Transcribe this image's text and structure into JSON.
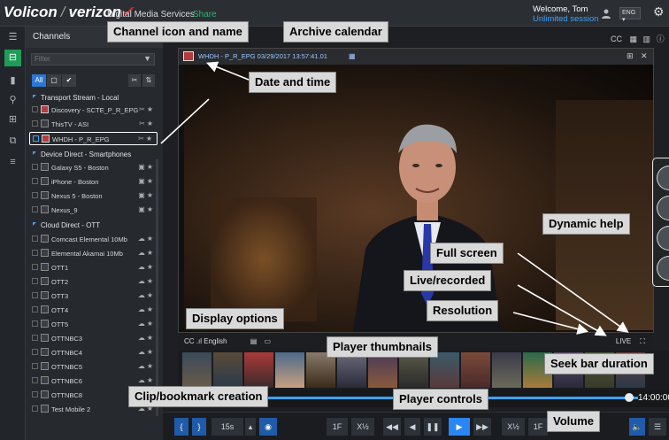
{
  "brand": {
    "name_left": "Volicon",
    "name_right": "verizon",
    "subtitle": "Digital Media Services",
    "share": "Share"
  },
  "user": {
    "welcome": "Welcome, Tom",
    "session": "Unlimited session",
    "language": "ENG"
  },
  "panel": {
    "title": "Channels",
    "filter_placeholder": "Filter",
    "chips": {
      "all": "All",
      "check": "✔"
    },
    "groups": [
      {
        "label": "Transport Stream - Local"
      },
      {
        "label": "Device Direct - Smartphones"
      },
      {
        "label": "Cloud Direct - OTT"
      }
    ],
    "channels": [
      {
        "name": "Discovery - SCTE_P_R_EPG"
      },
      {
        "name": "ThisTV - ASI"
      },
      {
        "name": "WHDH - P_R_EPG"
      },
      {
        "name": "Galaxy S5 - Boston"
      },
      {
        "name": "iPhone - Boston"
      },
      {
        "name": "Nexus 5 - Boston"
      },
      {
        "name": "Nexus_9"
      },
      {
        "name": "Comcast Elemental 10Mb"
      },
      {
        "name": "Elemental Akamai 10Mb"
      },
      {
        "name": "OTT1"
      },
      {
        "name": "OTT2"
      },
      {
        "name": "OTT3"
      },
      {
        "name": "OTT4"
      },
      {
        "name": "OTT5"
      },
      {
        "name": "OTTNBC3"
      },
      {
        "name": "OTTNBC4"
      },
      {
        "name": "OTTNBC5"
      },
      {
        "name": "OTTNBC6"
      },
      {
        "name": "OTTNBC8"
      },
      {
        "name": "Test Mobile 2"
      }
    ]
  },
  "header_right": {
    "cc": "CC"
  },
  "player": {
    "title": "WHDH - P_R_EPG   03/29/2017 13:57:41.01",
    "bottom_left": "CC   .ıl   English",
    "bottom_right": "LIVE",
    "seek_time": "14:00:00"
  },
  "controls": {
    "interval": "15s",
    "speed_1x_left": "1F",
    "speed_half_left": "X½",
    "speed_half_right": "X½",
    "speed_1x_right": "1F"
  },
  "callouts": {
    "channel_icon": "Channel icon and name",
    "archive_calendar": "Archive calendar",
    "date_time": "Date and time",
    "dynamic_help": "Dynamic help",
    "full_screen": "Full screen",
    "live_recorded": "Live/recorded",
    "resolution": "Resolution",
    "display_options": "Display options",
    "player_thumbnails": "Player thumbnails",
    "seek_bar_duration": "Seek bar duration",
    "clip_bookmark": "Clip/bookmark creation",
    "player_controls": "Player controls",
    "volume": "Volume"
  },
  "colors": {
    "accent_blue": "#2a86f2",
    "share_green": "#2bb673",
    "rail_active": "#1f9d57",
    "verizon_red": "#e3262c"
  }
}
